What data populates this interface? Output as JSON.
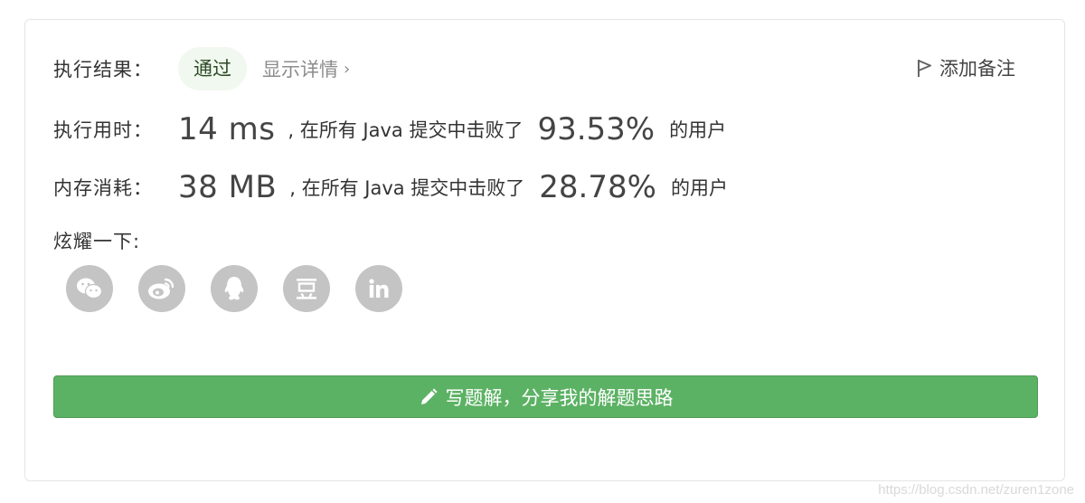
{
  "result": {
    "label": "执行结果：",
    "status": "通过",
    "details_link": "显示详情",
    "add_note": "添加备注"
  },
  "runtime": {
    "label": "执行用时：",
    "value": "14 ms",
    "middle_text": ", 在所有 Java 提交中击败了",
    "percent": "93.53%",
    "tail_text": "的用户"
  },
  "memory": {
    "label": "内存消耗：",
    "value": "38 MB",
    "middle_text": ", 在所有 Java 提交中击败了",
    "percent": "28.78%",
    "tail_text": "的用户"
  },
  "share": {
    "label": "炫耀一下:",
    "icons": [
      "wechat-icon",
      "weibo-icon",
      "qq-icon",
      "douban-icon",
      "linkedin-icon"
    ]
  },
  "write_solution": {
    "label": "写题解，分享我的解题思路",
    "icon": "pencil-icon"
  },
  "watermark": "https://blog.csdn.net/zuren1zone",
  "colors": {
    "accent_green": "#5cb264",
    "badge_bg": "#f1f8ef",
    "icon_gray": "#c4c4c4"
  }
}
